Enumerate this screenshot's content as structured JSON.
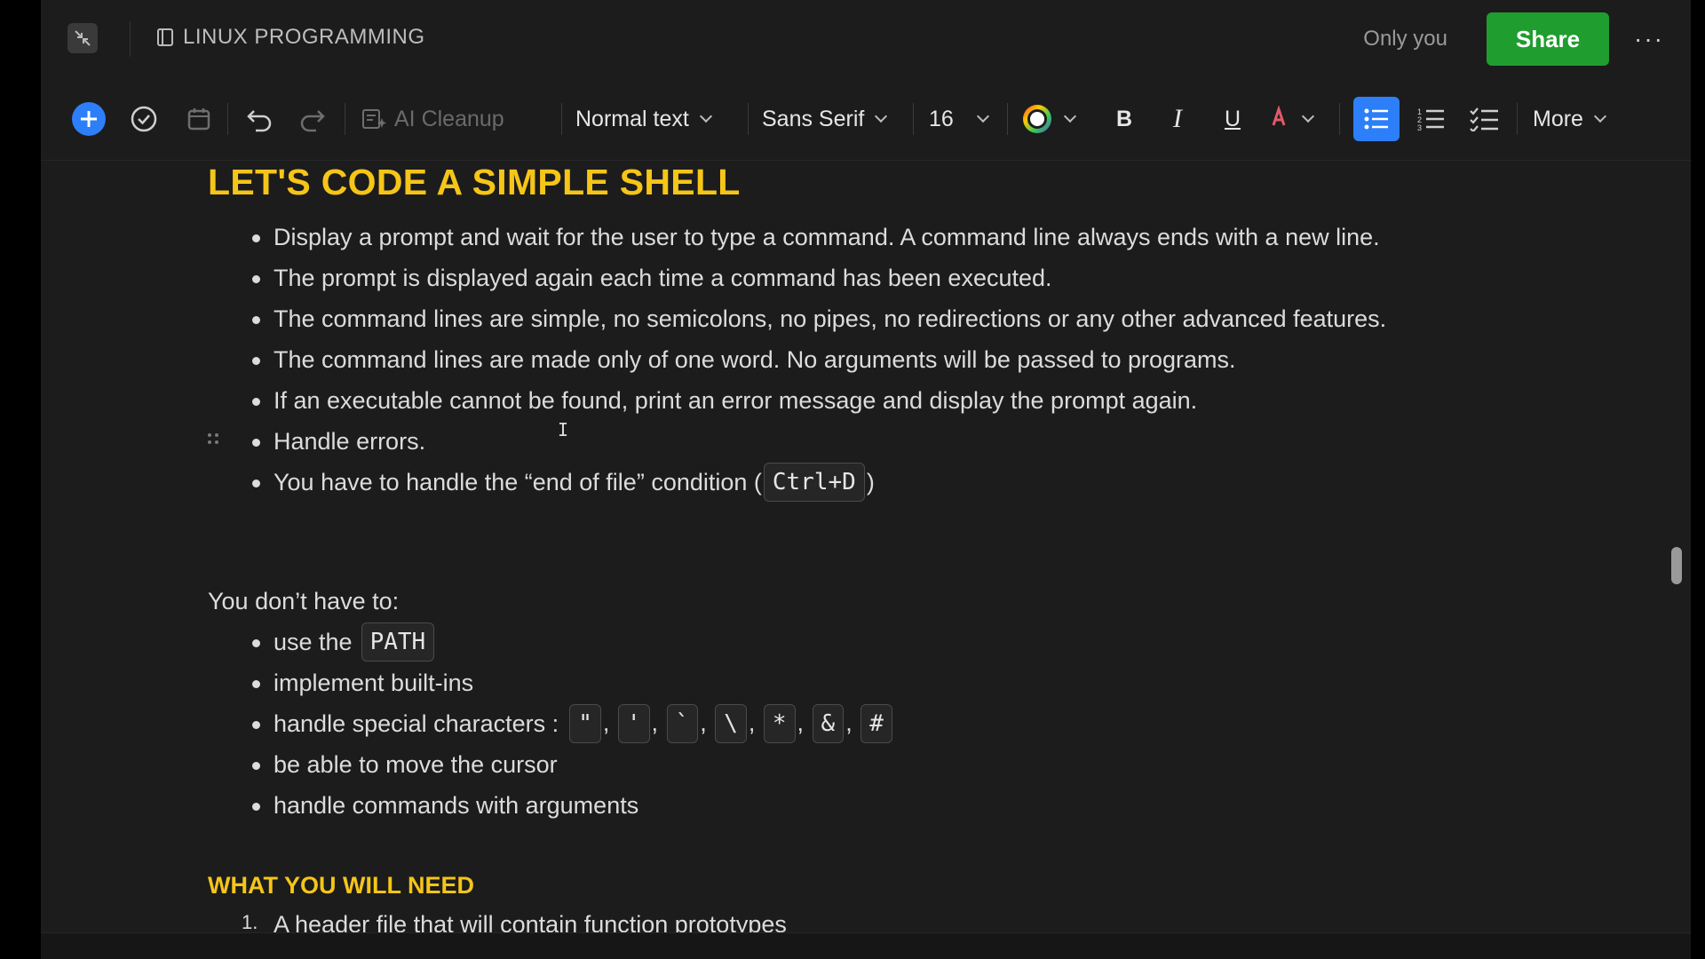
{
  "topbar": {
    "doc_title": "LINUX PROGRAMMING",
    "visibility": "Only you",
    "share_label": "Share",
    "more_label": "···"
  },
  "toolbar": {
    "ai_cleanup_label": "AI Cleanup",
    "text_style": "Normal text",
    "font_family": "Sans Serif",
    "font_size": "16",
    "bold_label": "B",
    "italic_label": "I",
    "underline_label": "U",
    "more_label": "More"
  },
  "content": {
    "heading": "LET'S CODE A SIMPLE SHELL",
    "bullets": [
      "Display a prompt and wait for the user to type a command. A command line always ends with a new line.",
      "The prompt is displayed again each time a command has been executed.",
      "The command lines are simple, no semicolons, no pipes, no redirections or any other advanced features.",
      "The command lines are made only of one word. No arguments will be passed to programs.",
      "If an executable cannot be found, print an error message and display the prompt again.",
      "Handle errors."
    ],
    "eof_prefix": "You have to handle the “end of file” condition (",
    "eof_code": "Ctrl+D",
    "eof_suffix": ")",
    "dont_have_to": "You don’t have to:",
    "use_the": "use the",
    "path_code": "PATH",
    "builtins": "implement built-ins",
    "special_prefix": "handle special characters :",
    "special_chars": [
      "\"",
      "'",
      "`",
      "\\",
      "*",
      "&",
      "#"
    ],
    "move_cursor": "be able to move the cursor",
    "with_args": "handle commands with arguments",
    "subheading": "WHAT YOU WILL NEED",
    "ol_number": "1.",
    "ol_first": "A header file that will contain function prototypes"
  },
  "colors": {
    "accent_yellow": "#f5c518",
    "share_green": "#1f9d2f",
    "active_blue": "#2d7ff9"
  }
}
